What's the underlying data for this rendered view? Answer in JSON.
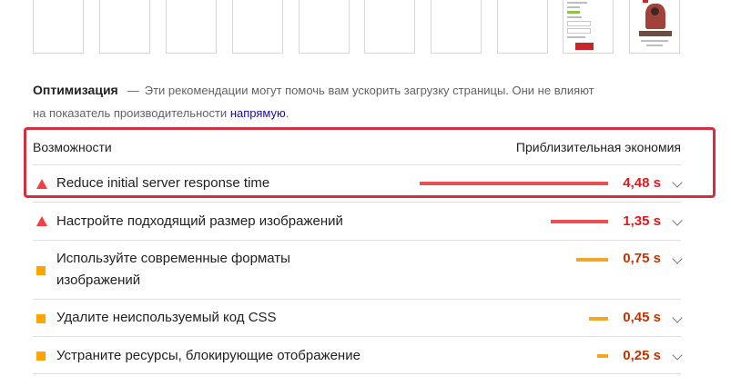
{
  "optimization": {
    "title": "Оптимизация",
    "dash": "—",
    "desc_line1": "Эти рекомендации могут помочь вам ускорить загрузку страницы. Они не влияют",
    "desc_line2": "на показатель производительности ",
    "link": "напрямую",
    "desc_end": "."
  },
  "table": {
    "col_opportunity": "Возможности",
    "col_savings": "Приблизительная экономия"
  },
  "rows": [
    {
      "label": "Reduce initial server response time",
      "value": "4,48 s",
      "severity": "fail",
      "bar_fraction": 1.0
    },
    {
      "label": "Настройте подходящий размер изображений",
      "value": "1,35 s",
      "severity": "fail",
      "bar_fraction": 0.3
    },
    {
      "label_line1": "Используйте современные форматы",
      "label_line2": "изображений",
      "value": "0,75 s",
      "severity": "average",
      "bar_fraction": 0.17
    },
    {
      "label": "Удалите неиспользуемый код CSS",
      "value": "0,45 s",
      "severity": "average",
      "bar_fraction": 0.1
    },
    {
      "label": "Устраните ресурсы, блокирующие отображение",
      "value": "0,25 s",
      "severity": "average",
      "bar_fraction": 0.06
    }
  ],
  "colors": {
    "fail": "#eb5050",
    "fail_text": "#e31818",
    "average": "#f5a623",
    "average_text": "#c33300",
    "highlight_border": "#d32f3f",
    "link": "#1a0dab"
  },
  "icons": {
    "fail": "triangle-icon",
    "average": "square-icon",
    "expand": "chevron-down-icon"
  }
}
